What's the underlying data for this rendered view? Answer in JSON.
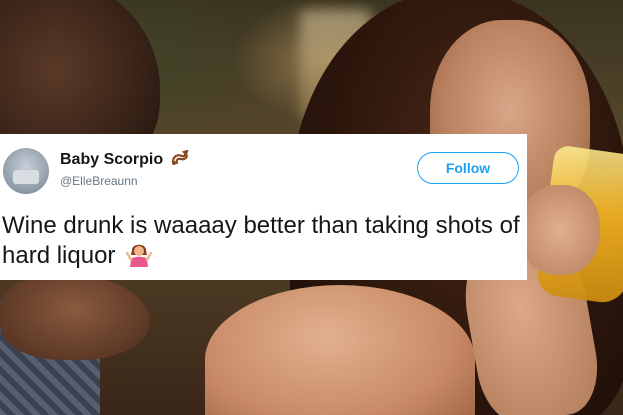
{
  "tweet": {
    "display_name": "Baby Scorpio",
    "badge_icon": "scorpion-icon",
    "handle": "@ElleBreaunn",
    "follow_label": "Follow",
    "text": "Wine drunk is waaaay better than taking shots of hard liquor",
    "emoji_icon": "person-shrugging-icon",
    "accent_color": "#1da1f2"
  }
}
